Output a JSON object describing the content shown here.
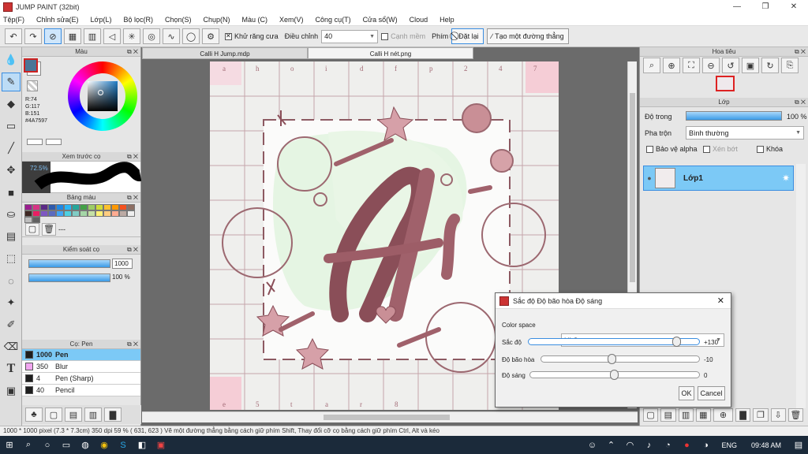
{
  "app": {
    "title": "JUMP PAINT (32bit)"
  },
  "menu": [
    "Tệp(F)",
    "Chỉnh sửa(E)",
    "Lớp(L)",
    "Bộ lọc(R)",
    "Chọn(S)",
    "Chụp(N)",
    "Màu (C)",
    "Xem(V)",
    "Công cụ(T)",
    "Cửa sổ(W)",
    "Cloud",
    "Help"
  ],
  "toolbar": {
    "antialias_label": "Khử răng cưa",
    "adjust_label": "Điều chỉnh",
    "adjust_value": "40",
    "smooth_label": "Cạnh mềm",
    "key_label": "Phím",
    "reset_label": "Đặt lại",
    "straight_label": "Tạo một đường thẳng"
  },
  "tabs": [
    "Calli H Jump.mdp",
    "Calli H nét.png"
  ],
  "color_panel": {
    "title": "Màu",
    "r": "R:74",
    "g": "G:117",
    "b": "B:151",
    "hex": "#4A7597",
    "main_color": "#4A7597"
  },
  "brush_preview": {
    "title": "Xem trước cọ",
    "opacity": "72.5%"
  },
  "palette": {
    "title": "Bảng màu",
    "label": "---",
    "colors": [
      "#9b1d8f",
      "#d63384",
      "#5b2a86",
      "#2e5aac",
      "#1e88e5",
      "#29b6f6",
      "#26a69a",
      "#43a047",
      "#9ccc65",
      "#cddc39",
      "#fbc02d",
      "#ff9800",
      "#f4511e",
      "#8d6e63",
      "#3e2723",
      "#e91e63",
      "#7e57c2",
      "#5c6bc0",
      "#42a5f5",
      "#4dd0e1",
      "#80cbc4",
      "#a5d6a7",
      "#c5e1a5",
      "#fff176",
      "#ffcc80",
      "#ffab91",
      "#bcaaa4",
      "#eeeeee",
      "#bdbdbd",
      "#616161"
    ]
  },
  "brush_control": {
    "title": "Kiểm soát cọ",
    "size": "1000",
    "opacity": "100 %"
  },
  "brush_list": {
    "title": "Cọ: Pen",
    "items": [
      {
        "size": "1000",
        "name": "Pen",
        "color": "#1e1e1e",
        "selected": true
      },
      {
        "size": "350",
        "name": "Blur",
        "color": "#f1a6f0",
        "selected": false
      },
      {
        "size": "4",
        "name": "Pen (Sharp)",
        "color": "#1e1e1e",
        "selected": false
      },
      {
        "size": "40",
        "name": "Pencil",
        "color": "#1e1e1e",
        "selected": false
      }
    ]
  },
  "canvas": {
    "letters_top": [
      "a",
      "h",
      "o",
      "i",
      "d",
      "f",
      "p",
      "2",
      "4",
      "7"
    ],
    "letters_bottom": [
      "e",
      "5",
      "t",
      "a",
      "r",
      "8"
    ]
  },
  "navigator": {
    "title": "Hoa tiêu"
  },
  "layer_panel": {
    "title": "Lớp",
    "opacity_label": "Độ trong",
    "opacity_value": "100 %",
    "blend_label": "Pha trộn",
    "blend_value": "Bình thường",
    "protect_alpha": "Bảo vệ alpha",
    "clipping": "Xén bớt",
    "lock": "Khóa",
    "layer_name": "Lớp1"
  },
  "dialog": {
    "title": "Sắc độ Độ bão hòa Độ sáng",
    "colorspace_label": "Color space",
    "colorspace_value": "HLS",
    "hue_label": "Sắc độ",
    "hue_value": "+130",
    "hue_fraction": 0.87,
    "sat_label": "Độ bão hòa",
    "sat_value": "-10",
    "sat_fraction": 0.45,
    "light_label": "Độ sáng",
    "light_value": "0",
    "light_fraction": 0.5,
    "ok": "OK",
    "cancel": "Cancel"
  },
  "statusbar": "1000 * 1000 pixel   (7.3 * 7.3cm)   350 dpi   59 %   ( 631, 623 )   Vẽ một đường thẳng bằng cách giữ phím Shift, Thay đổi cỡ cọ bằng cách giữ phím Ctrl, Alt và kéo",
  "taskbar": {
    "lang": "ENG",
    "time": "09:48 AM"
  }
}
